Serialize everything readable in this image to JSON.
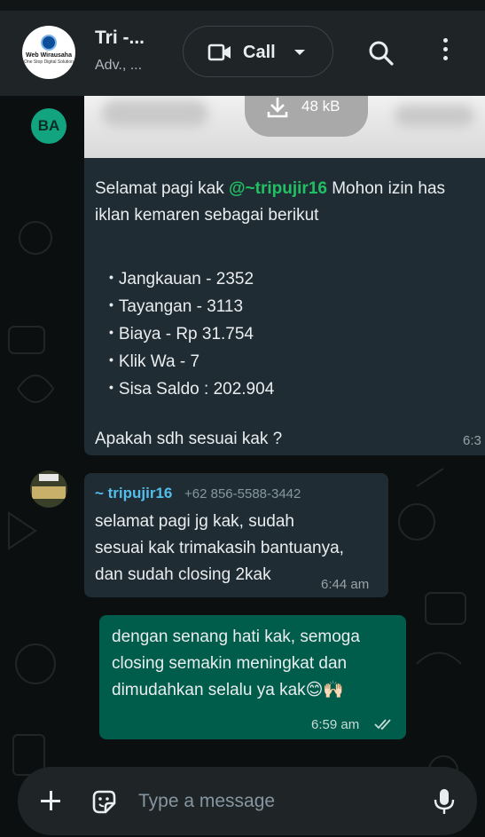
{
  "header": {
    "logo_line1": "Web Wirausaha",
    "logo_line2": "One Stop Digital Solution",
    "title": "Tri -...",
    "subtitle": "Adv., ...",
    "call_label": "Call",
    "icons": [
      "video-camera-icon",
      "chevron-down-icon",
      "search-icon",
      "more-vert-icon"
    ]
  },
  "messages": {
    "first": {
      "avatar_initials": "BA",
      "attachment_size": "48 kB",
      "line1_prefix": "Selamat pagi kak ",
      "line1_mention": "@~tripujir16",
      "line1_suffix": " Mohon izin has",
      "line2": "iklan kemaren sebagai berikut",
      "bullets": [
        "Jangkauan - 2352",
        "Tayangan - 3113",
        "Biaya - Rp 31.754",
        "Klik Wa - 7",
        "Sisa Saldo : 202.904"
      ],
      "closing": "Apakah sdh sesuai kak ?",
      "time": "6:3"
    },
    "second": {
      "sender": "~ tripujir16",
      "phone": "+62 856-5588-3442",
      "lines": [
        "selamat pagi jg kak, sudah",
        "sesuai kak trimakasih bantuanya,",
        "dan sudah closing 2kak"
      ],
      "time": "6:44 am"
    },
    "outgoing": {
      "lines": [
        "dengan senang hati kak, semoga",
        "closing semakin meningkat dan",
        "dimudahkan selalu ya kak😊🙌🏻"
      ],
      "time": "6:59 am",
      "status_icon": "double-check-icon"
    }
  },
  "composer": {
    "placeholder": "Type a message",
    "icons": [
      "plus-icon",
      "sticker-icon",
      "mic-icon"
    ]
  },
  "colors": {
    "incoming_bubble": "#202c33",
    "outgoing_bubble": "#005c4b",
    "mention": "#21c063",
    "sender_name": "#53bdeb"
  }
}
